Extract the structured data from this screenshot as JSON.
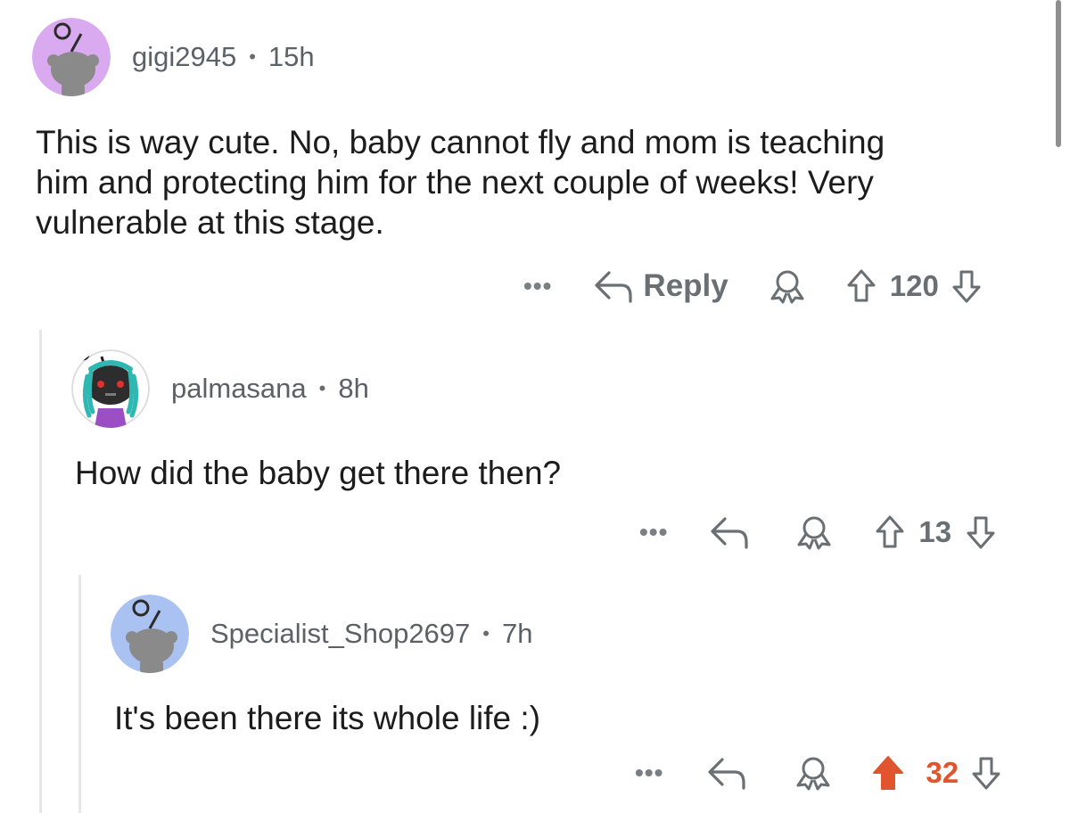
{
  "colors": {
    "upvote_active": "#e0542e",
    "meta_text": "#5b6166",
    "body_text": "#1c1c1c",
    "thread_line": "#e6e6e6"
  },
  "comments": [
    {
      "username": "gigi2945",
      "separator": "•",
      "time": "15h",
      "avatar_bg": "#d9aaf0",
      "body_lines": [
        "This is way cute. No, baby cannot fly and mom is teaching",
        "him and protecting him for the next couple of weeks! Very",
        "vulnerable at this stage."
      ],
      "actions": {
        "more": "•••",
        "reply_label": "Reply",
        "score": "120",
        "upvoted": false
      }
    },
    {
      "username": "palmasana",
      "separator": "•",
      "time": "8h",
      "avatar_bg": "#ffffff",
      "body_lines": [
        "How did the baby get there then?"
      ],
      "actions": {
        "more": "•••",
        "reply_label": "",
        "score": "13",
        "upvoted": false
      }
    },
    {
      "username": "Specialist_Shop2697",
      "separator": "•",
      "time": "7h",
      "avatar_bg": "#a9c2f2",
      "body_lines": [
        "It's been there its whole life :)"
      ],
      "actions": {
        "more": "•••",
        "reply_label": "",
        "score": "32",
        "upvoted": true
      }
    }
  ]
}
